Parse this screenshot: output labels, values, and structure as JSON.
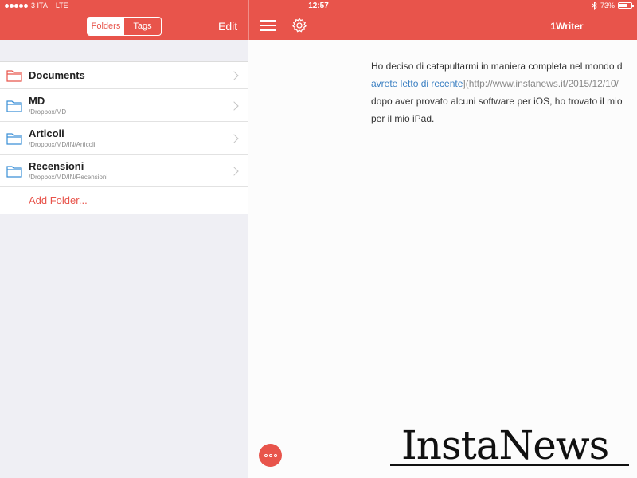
{
  "status_bar": {
    "carrier": "3 ITA",
    "network": "LTE",
    "time": "12:57",
    "battery": "73%",
    "battery_level": 0.73,
    "signal_bars": 5
  },
  "sidebar_header": {
    "segments": [
      "Folders",
      "Tags"
    ],
    "selected_segment": "Folders",
    "edit_label": "Edit"
  },
  "editor_header": {
    "title": "1Writer",
    "menu_icon": "hamburger-icon",
    "settings_icon": "gear-icon"
  },
  "folders": [
    {
      "name": "Documents",
      "path": "",
      "icon": "folder-icon",
      "color": "#e8544b"
    },
    {
      "name": "MD",
      "path": "/Dropbox/MD",
      "icon": "folder-icon",
      "color": "#3a8fd6"
    },
    {
      "name": "Articoli",
      "path": "/Dropbox/MD/IN/Articoli",
      "icon": "folder-icon",
      "color": "#3a8fd6"
    },
    {
      "name": "Recensioni",
      "path": "/Dropbox/MD/IN/Recensioni",
      "icon": "folder-icon",
      "color": "#3a8fd6"
    }
  ],
  "add_folder_label": "Add Folder...",
  "editor": {
    "line1": "Ho deciso di catapultarmi in maniera completa nel mondo d",
    "link_text": "avrete letto di recente",
    "link_url": "](http://www.instanews.it/2015/12/10/",
    "line3": "dopo aver provato alcuni software per iOS, ho trovato il mio",
    "line4": "per il mio iPad."
  },
  "watermark": "InstaNews",
  "colors": {
    "accent": "#e8544b",
    "link": "#3a7fc2",
    "folder_blue": "#3a8fd6"
  }
}
